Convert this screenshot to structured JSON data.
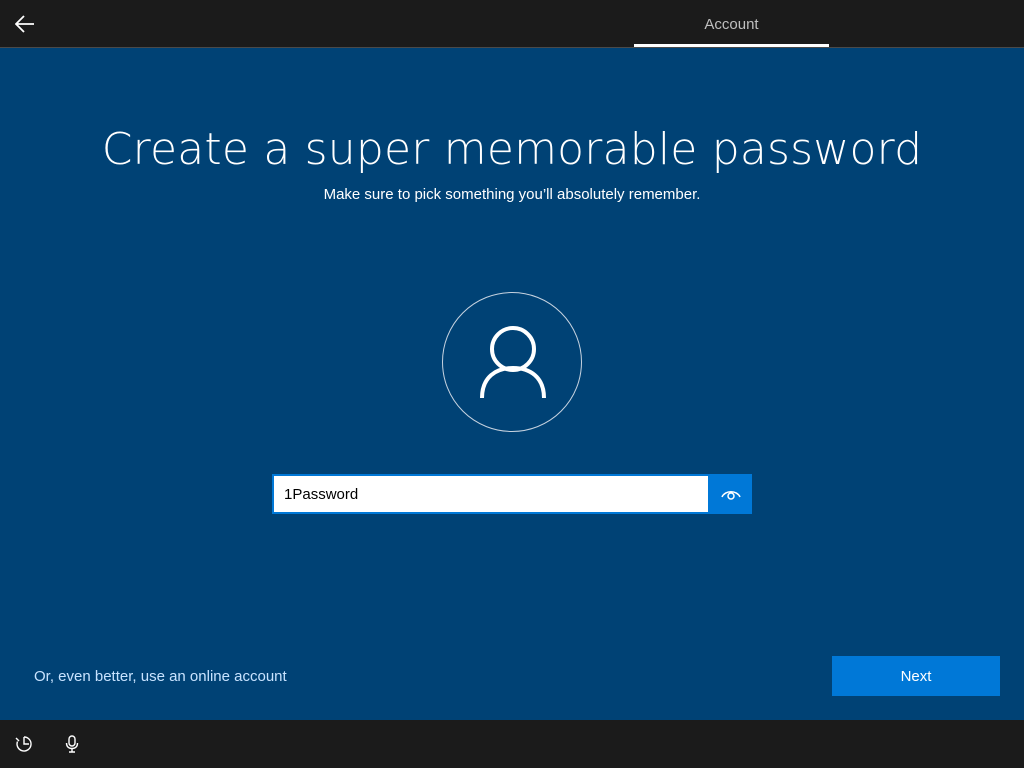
{
  "header": {
    "back_icon": "back-arrow-icon",
    "tab_label": "Account"
  },
  "main": {
    "title": "Create a super memorable password",
    "subtitle": "Make sure to pick something you’ll absolutely remember.",
    "avatar_icon": "user-icon",
    "password": {
      "value": "1Password",
      "reveal_icon": "eye-icon"
    },
    "online_account_link": "Or, even better, use an online account",
    "next_label": "Next"
  },
  "footer": {
    "icons": [
      "ease-of-access-icon",
      "microphone-icon"
    ]
  },
  "colors": {
    "background": "#004275",
    "bar": "#1b1b1b",
    "accent": "#0078d7",
    "link": "#c8e3ff"
  }
}
